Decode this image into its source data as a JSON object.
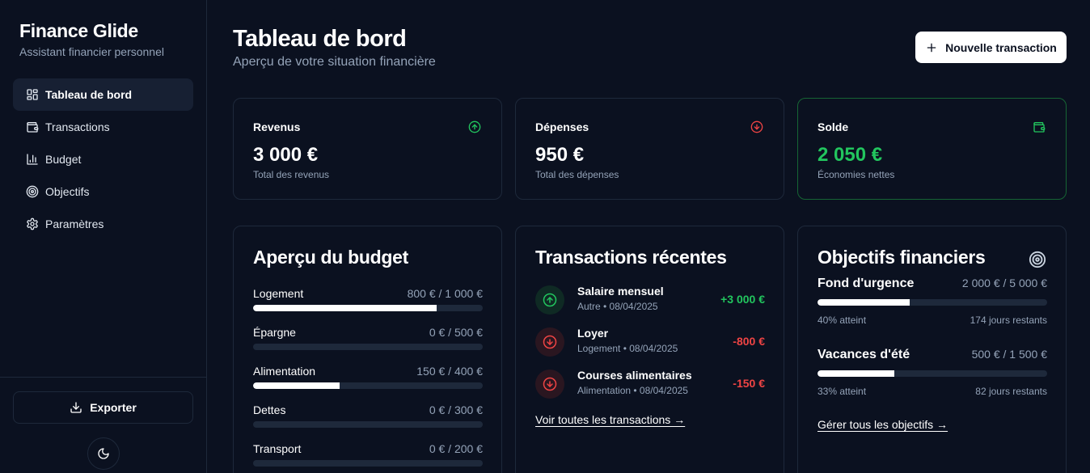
{
  "app": {
    "name": "Finance Glide",
    "tagline": "Assistant financier personnel"
  },
  "sidebar": {
    "items": [
      {
        "label": "Tableau de bord",
        "icon": "dashboard-icon",
        "active": true
      },
      {
        "label": "Transactions",
        "icon": "wallet-icon",
        "active": false
      },
      {
        "label": "Budget",
        "icon": "bar-chart-icon",
        "active": false
      },
      {
        "label": "Objectifs",
        "icon": "target-icon",
        "active": false
      },
      {
        "label": "Paramètres",
        "icon": "gear-icon",
        "active": false
      }
    ],
    "export_label": "Exporter",
    "theme_icon": "moon-icon"
  },
  "header": {
    "title": "Tableau de bord",
    "subtitle": "Aperçu de votre situation financière",
    "new_transaction_label": "Nouvelle transaction"
  },
  "stats": [
    {
      "label": "Revenus",
      "value": "3 000 €",
      "desc": "Total des revenus",
      "icon": "arrow-up-circle-icon",
      "color": "#22c55e"
    },
    {
      "label": "Dépenses",
      "value": "950 €",
      "desc": "Total des dépenses",
      "icon": "arrow-down-circle-icon",
      "color": "#ef4444"
    },
    {
      "label": "Solde",
      "value": "2 050 €",
      "desc": "Économies nettes",
      "icon": "wallet-icon",
      "color": "#22c55e"
    }
  ],
  "budget": {
    "title": "Aperçu du budget",
    "items": [
      {
        "label": "Logement",
        "amount": "800 € / 1 000 €",
        "progress": 0.8
      },
      {
        "label": "Épargne",
        "amount": "0 € / 500 €",
        "progress": 0
      },
      {
        "label": "Alimentation",
        "amount": "150 € / 400 €",
        "progress": 0.375
      },
      {
        "label": "Dettes",
        "amount": "0 € / 300 €",
        "progress": 0
      },
      {
        "label": "Transport",
        "amount": "0 € / 200 €",
        "progress": 0
      }
    ]
  },
  "transactions": {
    "title": "Transactions récentes",
    "items": [
      {
        "name": "Salaire mensuel",
        "meta": "Autre • 08/04/2025",
        "amount": "+3 000 €",
        "type": "income"
      },
      {
        "name": "Loyer",
        "meta": "Logement • 08/04/2025",
        "amount": "-800 €",
        "type": "expense"
      },
      {
        "name": "Courses alimentaires",
        "meta": "Alimentation • 08/04/2025",
        "amount": "-150 €",
        "type": "expense"
      }
    ],
    "view_all_label": "Voir toutes les transactions →"
  },
  "goals": {
    "title": "Objectifs financiers",
    "items": [
      {
        "name": "Fond d'urgence",
        "amount": "2 000 € / 5 000 €",
        "progress": 0.4,
        "percent_label": "40% atteint",
        "days_label": "174 jours restants"
      },
      {
        "name": "Vacances d'été",
        "amount": "500 € / 1 500 €",
        "progress": 0.333,
        "percent_label": "33% atteint",
        "days_label": "82 jours restants"
      }
    ],
    "manage_label": "Gérer tous les objectifs →"
  },
  "colors": {
    "background": "#0b1120",
    "border": "#1e293b",
    "income": "#22c55e",
    "expense": "#ef4444",
    "muted": "#94a3b8"
  }
}
